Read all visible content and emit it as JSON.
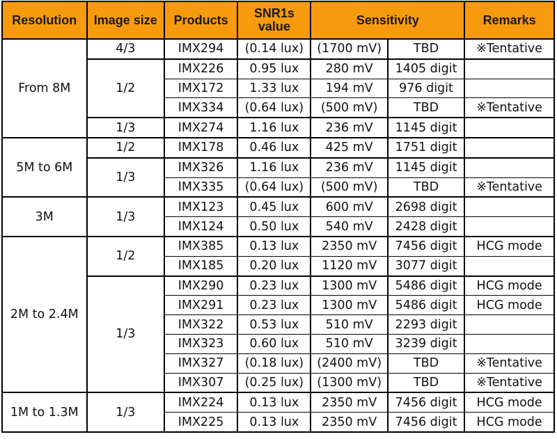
{
  "headers": {
    "resolution": "Resolution",
    "image_size": "Image size",
    "products": "Products",
    "snr1s": "SNR1s value",
    "sensitivity": "Sensitivity",
    "remarks": "Remarks"
  },
  "colors": {
    "header_bg": "#f79a0e",
    "border": "#000000"
  },
  "groups": [
    {
      "resolution": "From 8M",
      "sizes": [
        {
          "size": "4/3",
          "rows": [
            {
              "product": "IMX294",
              "snr": "(0.14 lux)",
              "mv": "(1700 mV)",
              "digit": "TBD",
              "remark": "※Tentative"
            }
          ]
        },
        {
          "size": "1/2",
          "rows": [
            {
              "product": "IMX226",
              "snr": "0.95 lux",
              "mv": "280 mV",
              "digit": "1405 digit",
              "remark": ""
            },
            {
              "product": "IMX172",
              "snr": "1.33 lux",
              "mv": "194 mV",
              "digit": "976 digit",
              "remark": ""
            },
            {
              "product": "IMX334",
              "snr": "(0.64 lux)",
              "mv": "(500 mV)",
              "digit": "TBD",
              "remark": "※Tentative"
            }
          ]
        },
        {
          "size": "1/3",
          "rows": [
            {
              "product": "IMX274",
              "snr": "1.16 lux",
              "mv": "236 mV",
              "digit": "1145 digit",
              "remark": ""
            }
          ]
        }
      ]
    },
    {
      "resolution": "5M to 6M",
      "sizes": [
        {
          "size": "1/2",
          "rows": [
            {
              "product": "IMX178",
              "snr": "0.46 lux",
              "mv": "425 mV",
              "digit": "1751 digit",
              "remark": ""
            }
          ]
        },
        {
          "size": "1/3",
          "rows": [
            {
              "product": "IMX326",
              "snr": "1.16 lux",
              "mv": "236 mV",
              "digit": "1145 digit",
              "remark": ""
            },
            {
              "product": "IMX335",
              "snr": "(0.64 lux)",
              "mv": "(500 mV)",
              "digit": "TBD",
              "remark": "※Tentative"
            }
          ]
        }
      ]
    },
    {
      "resolution": "3M",
      "sizes": [
        {
          "size": "1/3",
          "rows": [
            {
              "product": "IMX123",
              "snr": "0.45 lux",
              "mv": "600 mV",
              "digit": "2698 digit",
              "remark": ""
            },
            {
              "product": "IMX124",
              "snr": "0.50 lux",
              "mv": "540 mV",
              "digit": "2428 digit",
              "remark": ""
            }
          ]
        }
      ]
    },
    {
      "resolution": "2M to 2.4M",
      "sizes": [
        {
          "size": "1/2",
          "rows": [
            {
              "product": "IMX385",
              "snr": "0.13 lux",
              "mv": "2350 mV",
              "digit": "7456 digit",
              "remark": "HCG mode"
            },
            {
              "product": "IMX185",
              "snr": "0.20 lux",
              "mv": "1120 mV",
              "digit": "3077 digit",
              "remark": ""
            }
          ]
        },
        {
          "size": "1/3",
          "rows": [
            {
              "product": "IMX290",
              "snr": "0.23 lux",
              "mv": "1300 mV",
              "digit": "5486 digit",
              "remark": "HCG mode"
            },
            {
              "product": "IMX291",
              "snr": "0.23 lux",
              "mv": "1300 mV",
              "digit": "5486 digit",
              "remark": "HCG mode"
            },
            {
              "product": "IMX322",
              "snr": "0.53 lux",
              "mv": "510 mV",
              "digit": "2293 digit",
              "remark": ""
            },
            {
              "product": "IMX323",
              "snr": "0.60 lux",
              "mv": "510 mV",
              "digit": "3239 digit",
              "remark": ""
            },
            {
              "product": "IMX327",
              "snr": "(0.18 lux)",
              "mv": "(2400 mV)",
              "digit": "TBD",
              "remark": "※Tentative"
            },
            {
              "product": "IMX307",
              "snr": "(0.25 lux)",
              "mv": "(1300 mV)",
              "digit": "TBD",
              "remark": "※Tentative"
            }
          ]
        }
      ]
    },
    {
      "resolution": "1M to 1.3M",
      "sizes": [
        {
          "size": "1/3",
          "rows": [
            {
              "product": "IMX224",
              "snr": "0.13 lux",
              "mv": "2350 mV",
              "digit": "7456 digit",
              "remark": "HCG mode"
            },
            {
              "product": "IMX225",
              "snr": "0.13 lux",
              "mv": "2350 mV",
              "digit": "7456 digit",
              "remark": "HCG mode"
            }
          ]
        }
      ]
    }
  ]
}
